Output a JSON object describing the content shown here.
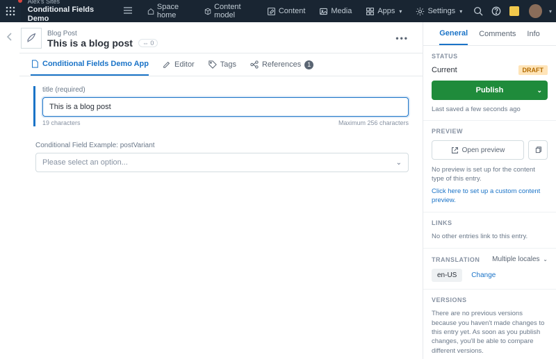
{
  "topbar": {
    "org_label": "Alex's Sites",
    "space_name": "Conditional Fields Demo",
    "nav": {
      "home": "Space home",
      "model": "Content model",
      "content": "Content",
      "media": "Media",
      "apps": "Apps",
      "settings": "Settings"
    }
  },
  "entry": {
    "type": "Blog Post",
    "title": "This is a blog post",
    "link_count": "0"
  },
  "tabs": {
    "demo_app": "Conditional Fields Demo App",
    "editor": "Editor",
    "tags": "Tags",
    "references": "References",
    "ref_count": "1"
  },
  "fields": {
    "title_label": "title (required)",
    "title_value": "This is a blog post",
    "char_count": "19 characters",
    "char_max": "Maximum 256 characters",
    "variant_label": "Conditional Field Example: postVariant",
    "variant_placeholder": "Please select an option..."
  },
  "sidebar": {
    "tabs": {
      "general": "General",
      "comments": "Comments",
      "info": "Info"
    },
    "status": {
      "heading": "STATUS",
      "value": "Current",
      "badge": "DRAFT",
      "publish": "Publish",
      "last_saved": "Last saved a few seconds ago"
    },
    "preview": {
      "heading": "PREVIEW",
      "open": "Open preview",
      "none": "No preview is set up for the content type of this entry.",
      "setup": "Click here to set up a custom content preview."
    },
    "links": {
      "heading": "LINKS",
      "none": "No other entries link to this entry."
    },
    "translation": {
      "heading": "TRANSLATION",
      "multiple": "Multiple locales",
      "locale": "en-US",
      "change": "Change"
    },
    "versions": {
      "heading": "VERSIONS",
      "text": "There are no previous versions because you haven't made changes to this entry yet. As soon as you publish changes, you'll be able to compare different versions."
    }
  }
}
